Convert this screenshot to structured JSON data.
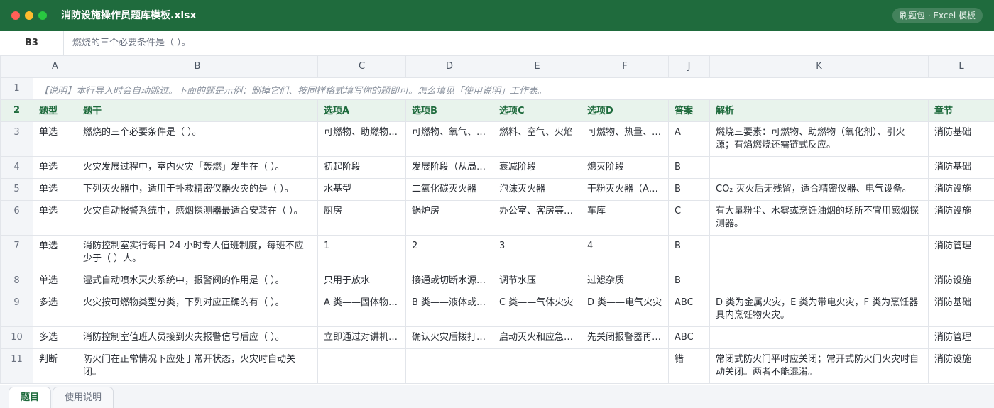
{
  "window": {
    "title": "消防设施操作员题库模板.xlsx",
    "badge": "刷题包 · Excel 模板"
  },
  "formula_bar": {
    "cell_ref": "B3",
    "content": "燃烧的三个必要条件是（ ）。"
  },
  "colors": {
    "brand": "#1f6b3d",
    "header_fill": "#e8f3ec"
  },
  "columns": [
    "A",
    "B",
    "C",
    "D",
    "E",
    "F",
    "J",
    "K",
    "L"
  ],
  "note_row": {
    "num": "1",
    "text": "【说明】本行导入时会自动跳过。下面的题是示例：删掉它们、按同样格式填写你的题即可。怎么填见「使用说明」工作表。"
  },
  "header_row": {
    "num": "2",
    "cells": [
      "题型",
      "题干",
      "选项A",
      "选项B",
      "选项C",
      "选项D",
      "答案",
      "解析",
      "章节"
    ]
  },
  "rows": [
    {
      "num": "3",
      "cells": [
        "单选",
        "燃烧的三个必要条件是（ ）。",
        "可燃物、助燃物…",
        "可燃物、氧气、…",
        "燃料、空气、火焰",
        "可燃物、热量、…",
        "A",
        "燃烧三要素：可燃物、助燃物（氧化剂）、引火源；有焰燃烧还需链式反应。",
        "消防基础"
      ]
    },
    {
      "num": "4",
      "cells": [
        "单选",
        "火灾发展过程中，室内火灾「轰燃」发生在（ ）。",
        "初起阶段",
        "发展阶段（从局…",
        "衰减阶段",
        "熄灭阶段",
        "B",
        "",
        "消防基础"
      ]
    },
    {
      "num": "5",
      "cells": [
        "单选",
        "下列灭火器中，适用于扑救精密仪器火灾的是（ ）。",
        "水基型",
        "二氧化碳灭火器",
        "泡沫灭火器",
        "干粉灭火器（A…",
        "B",
        "CO₂ 灭火后无残留，适合精密仪器、电气设备。",
        "消防设施"
      ]
    },
    {
      "num": "6",
      "cells": [
        "单选",
        "火灾自动报警系统中，感烟探测器最适合安装在（ ）。",
        "厨房",
        "锅炉房",
        "办公室、客房等…",
        "车库",
        "C",
        "有大量粉尘、水雾或烹饪油烟的场所不宜用感烟探测器。",
        "消防设施"
      ]
    },
    {
      "num": "7",
      "cells": [
        "单选",
        "消防控制室实行每日 24 小时专人值班制度，每班不应少于（ ）人。",
        "1",
        "2",
        "3",
        "4",
        "B",
        "",
        "消防管理"
      ]
    },
    {
      "num": "8",
      "cells": [
        "单选",
        "湿式自动喷水灭火系统中，报警阀的作用是（ ）。",
        "只用于放水",
        "接通或切断水源…",
        "调节水压",
        "过滤杂质",
        "B",
        "",
        "消防设施"
      ]
    },
    {
      "num": "9",
      "cells": [
        "多选",
        "火灾按可燃物类型分类，下列对应正确的有（ ）。",
        "A 类——固体物…",
        "B 类——液体或…",
        "C 类——气体火灾",
        "D 类——电气火灾",
        "ABC",
        "D 类为金属火灾，E 类为带电火灾，F 类为烹饪器具内烹饪物火灾。",
        "消防基础"
      ]
    },
    {
      "num": "10",
      "cells": [
        "多选",
        "消防控制室值班人员接到火灾报警信号后应（ ）。",
        "立即通过对讲机…",
        "确认火灾后拨打…",
        "启动灭火和应急…",
        "先关闭报警器再…",
        "ABC",
        "",
        "消防管理"
      ]
    },
    {
      "num": "11",
      "cells": [
        "判断",
        "防火门在正常情况下应处于常开状态，火灾时自动关闭。",
        "",
        "",
        "",
        "",
        "错",
        "常闭式防火门平时应关闭；常开式防火门火灾时自动关闭。两者不能混淆。",
        "消防设施"
      ]
    }
  ],
  "sheet_tabs": [
    {
      "label": "题目",
      "active": true
    },
    {
      "label": "使用说明",
      "active": false
    }
  ]
}
